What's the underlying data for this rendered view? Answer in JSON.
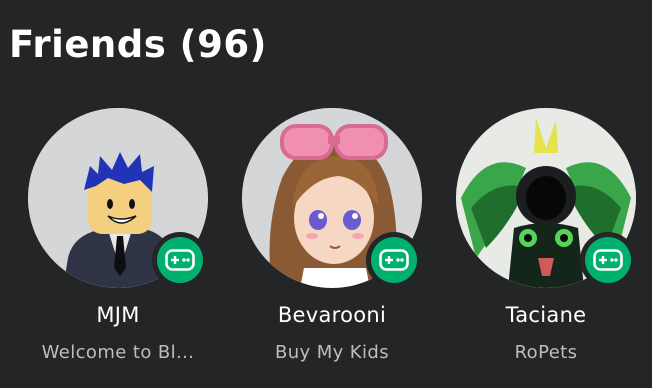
{
  "section": {
    "title": "Friends (96)"
  },
  "friends": [
    {
      "name": "MJM",
      "status": "Welcome to Bl...",
      "presence": "in-game",
      "presence_icon": "gamepad-icon"
    },
    {
      "name": "Bevarooni",
      "status": "Buy My Kids",
      "presence": "in-game",
      "presence_icon": "gamepad-icon"
    },
    {
      "name": "Taciane",
      "status": "RoPets",
      "presence": "in-game",
      "presence_icon": "gamepad-icon"
    }
  ],
  "colors": {
    "background": "#232527",
    "presence_in_game": "#00b06f",
    "status_text": "#bdbebe",
    "avatar_bg": "#d5d6d8"
  }
}
